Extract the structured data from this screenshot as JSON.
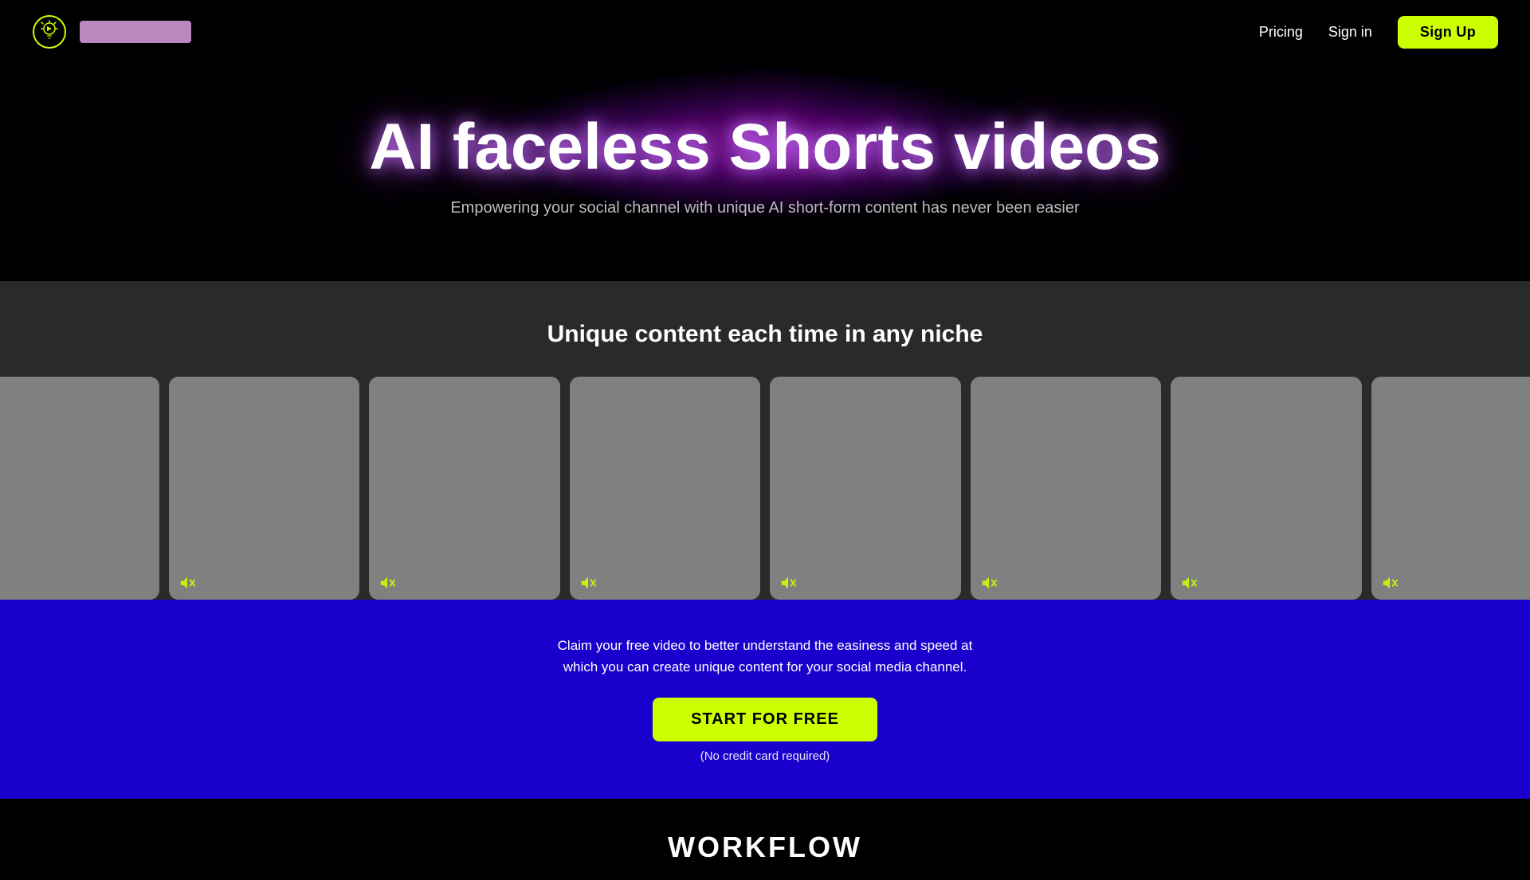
{
  "nav": {
    "logo_alt": "AI Video Logo",
    "logo_text_placeholder": "",
    "links": [
      {
        "id": "pricing",
        "label": "Pricing"
      },
      {
        "id": "signin",
        "label": "Sign in"
      }
    ],
    "signup_label": "Sign Up"
  },
  "hero": {
    "title": "AI faceless Shorts videos",
    "subtitle": "Empowering your social channel with unique AI short-form content has never been easier"
  },
  "video_section": {
    "title": "Unique content each time in any niche",
    "cards": [
      {
        "id": "card-1",
        "muted": true
      },
      {
        "id": "card-2",
        "muted": true
      },
      {
        "id": "card-3",
        "muted": true
      },
      {
        "id": "card-4",
        "muted": true
      },
      {
        "id": "card-5",
        "muted": true
      },
      {
        "id": "card-6",
        "muted": true
      },
      {
        "id": "card-7",
        "muted": true
      },
      {
        "id": "card-8",
        "muted": true
      }
    ]
  },
  "cta": {
    "text_line1": "Claim your free video to better understand the easiness and speed at",
    "text_line2": "which you can create unique content for your social media channel.",
    "button_label": "START FOR FREE",
    "no_cc_label": "(No credit card required)"
  },
  "workflow": {
    "title": "WORKFLOW"
  },
  "colors": {
    "accent_yellow": "#ccff00",
    "accent_purple": "#a020c0",
    "cta_bg": "#1a00cc",
    "card_bg": "#808080",
    "logo_placeholder": "#d9a0e0"
  }
}
